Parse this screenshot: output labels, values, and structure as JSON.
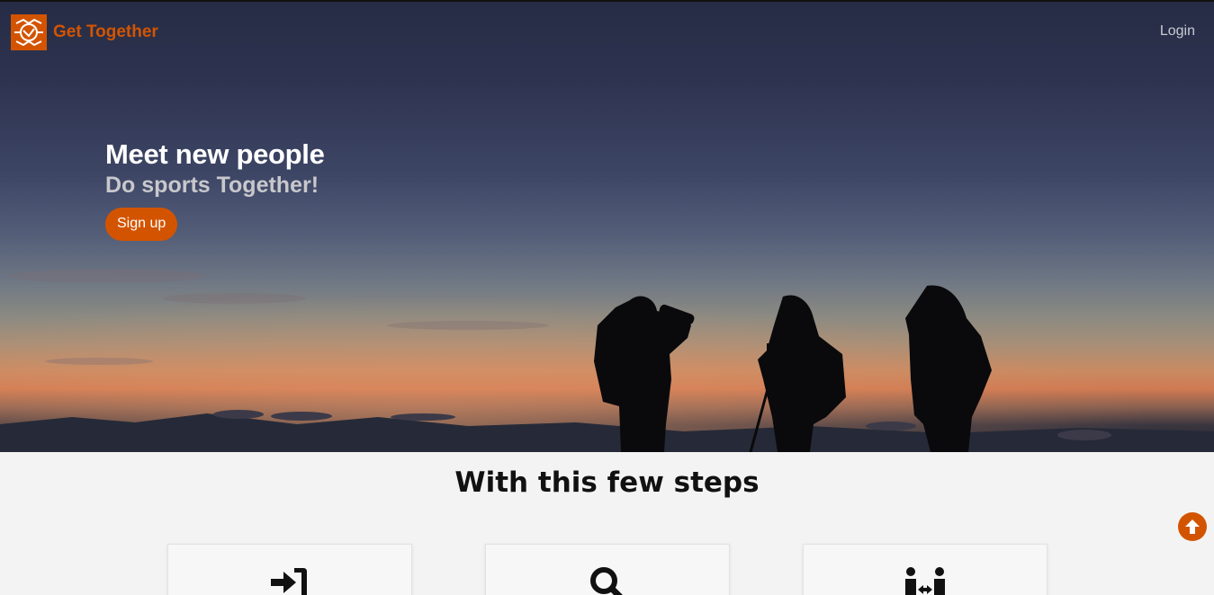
{
  "nav": {
    "brand_name": "Get Together",
    "login_label": "Login",
    "brand_icon": "handshake-logo-icon"
  },
  "hero": {
    "headline": "Meet new people",
    "subline": "Do sports Together!",
    "signup_label": "Sign up"
  },
  "steps": {
    "title": "With this few steps",
    "items": [
      {
        "icon": "sign-in-icon"
      },
      {
        "icon": "search-icon"
      },
      {
        "icon": "people-exchange-icon"
      }
    ]
  },
  "colors": {
    "accent": "#d35400",
    "page_bg": "#f3f3f3"
  }
}
